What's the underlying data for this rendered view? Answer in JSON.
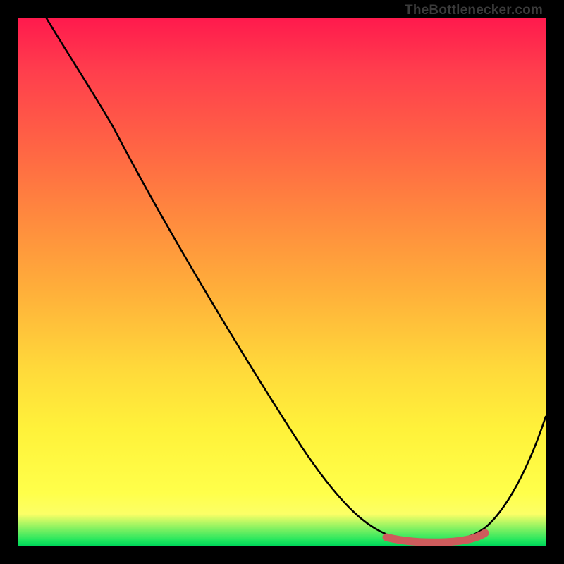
{
  "attribution": "TheBottlenecker.com",
  "chart_data": {
    "type": "line",
    "title": "",
    "xlabel": "",
    "ylabel": "",
    "xlim": [
      0,
      100
    ],
    "ylim": [
      0,
      100
    ],
    "series": [
      {
        "name": "bottleneck-curve",
        "x": [
          0,
          5,
          10,
          15,
          20,
          25,
          30,
          35,
          40,
          45,
          50,
          55,
          60,
          65,
          70,
          73,
          76,
          79,
          82,
          85,
          88,
          91,
          94,
          97,
          100
        ],
        "values": [
          100,
          96,
          91,
          84,
          77,
          70,
          63,
          56,
          49,
          42,
          35,
          28,
          21,
          14,
          7,
          3,
          1,
          0,
          0,
          0,
          1,
          5,
          12,
          21,
          32
        ]
      }
    ],
    "highlight": {
      "x_start": 73,
      "x_end": 86,
      "color": "#ce5b5c"
    },
    "gradient_stops": [
      {
        "pct": 0,
        "color": "#ff1a4d"
      },
      {
        "pct": 25,
        "color": "#ff6644"
      },
      {
        "pct": 55,
        "color": "#ffc040"
      },
      {
        "pct": 85,
        "color": "#ffff50"
      },
      {
        "pct": 100,
        "color": "#00d65a"
      }
    ]
  }
}
